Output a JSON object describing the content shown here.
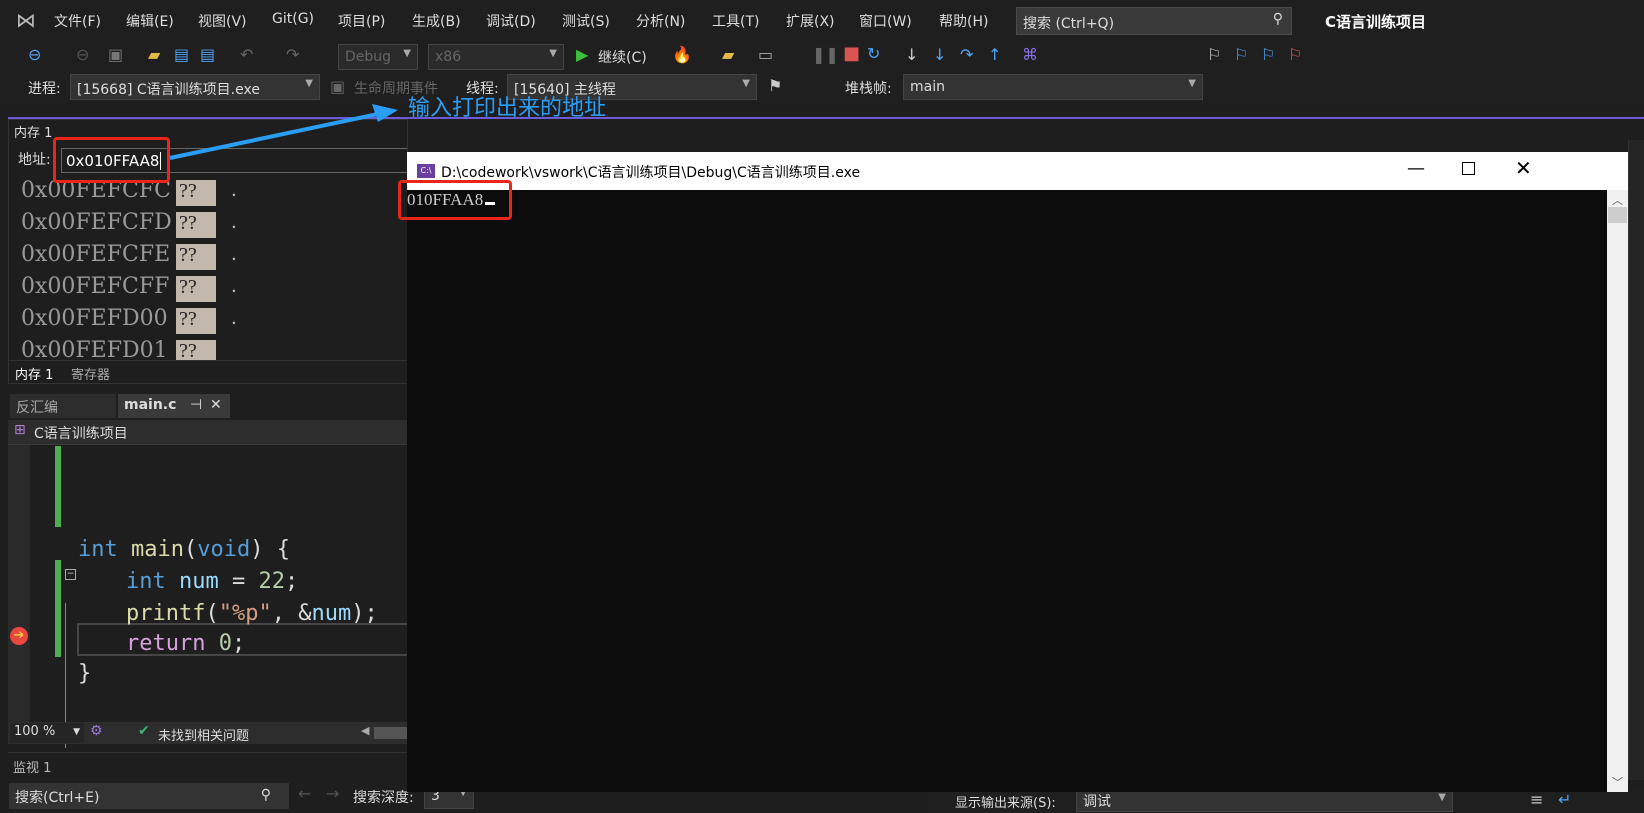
{
  "menu": {
    "items": [
      "文件(F)",
      "编辑(E)",
      "视图(V)",
      "Git(G)",
      "项目(P)",
      "生成(B)",
      "调试(D)",
      "测试(S)",
      "分析(N)",
      "工具(T)",
      "扩展(X)",
      "窗口(W)",
      "帮助(H)"
    ],
    "search_placeholder": "搜索 (Ctrl+Q)",
    "solution_title": "C语言训练项目"
  },
  "toolbar": {
    "config": "Debug",
    "platform": "x86",
    "continue_label": "继续(C)"
  },
  "debug_location": {
    "process_label": "进程:",
    "process": "[15668] C语言训练项目.exe",
    "lifecycle_label": "生命周期事件",
    "thread_label": "线程:",
    "thread": "[15640] 主线程",
    "stack_label": "堆栈帧:",
    "stack": "main"
  },
  "annotation": {
    "text": "输入打印出来的地址",
    "color": "#2a9df4"
  },
  "memory": {
    "title": "内存 1",
    "address_label": "地址:",
    "address_value": "0x010FFAA8",
    "rows": [
      {
        "addr": "0x00FEFCFC",
        "byte": "??",
        "char": "."
      },
      {
        "addr": "0x00FEFCFD",
        "byte": "??",
        "char": "."
      },
      {
        "addr": "0x00FEFCFE",
        "byte": "??",
        "char": "."
      },
      {
        "addr": "0x00FEFCFF",
        "byte": "??",
        "char": "."
      },
      {
        "addr": "0x00FEFD00",
        "byte": "??",
        "char": "."
      },
      {
        "addr": "0x00FEFD01",
        "byte": "??",
        "char": ""
      }
    ],
    "tabs": [
      "内存 1",
      "寄存器"
    ]
  },
  "editor": {
    "tabs": [
      "反汇编",
      "main.c"
    ],
    "project": "C语言训练项目",
    "code": {
      "l1a": "int",
      "l1b": " main",
      "l1c": "(",
      "l1d": "void",
      "l1e": ") {",
      "l2a": "int",
      "l2b": " num ",
      "l2c": "= ",
      "l2d": "22",
      "l2e": ";",
      "l3a": "printf",
      "l3b": "(",
      "l3c": "\"%p\"",
      "l3d": ", &",
      "l3e": "num",
      "l3f": ");",
      "l4a": "return",
      "l4b": " 0",
      "l4c": ";",
      "l5": "}"
    },
    "zoom": "100 %",
    "issues": "未找到相关问题"
  },
  "watch": {
    "title": "监视 1",
    "search_placeholder": "搜索(Ctrl+E)",
    "depth_label": "搜索深度:",
    "depth": "3"
  },
  "console": {
    "title": "D:\\codework\\vswork\\C语言训练项目\\Debug\\C语言训练项目.exe",
    "output": "010FFAA8"
  },
  "output": {
    "source_label": "显示输出来源(S):",
    "source": "调试"
  }
}
